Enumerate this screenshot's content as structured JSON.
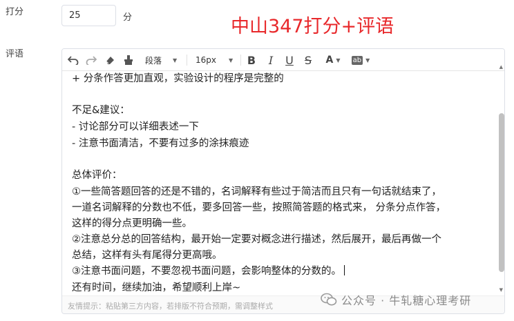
{
  "form": {
    "score_label": "打分",
    "score_value": "25",
    "score_unit": "分",
    "comment_label": "评语"
  },
  "overlay_title": "中山347打分+评语",
  "toolbar": {
    "undo_icon": "undo-icon",
    "redo_icon": "redo-icon",
    "clear_format_icon": "eraser-icon",
    "format_painter_icon": "format-painter-icon",
    "paragraph_label": "段落",
    "font_size_label": "16px",
    "bold_label": "B",
    "italic_label": "I",
    "underline_label": "U",
    "strike_label": "S",
    "font_color_label": "A",
    "bg_color_label": "ab"
  },
  "content_lines": [
    "+ 分条作答更加直观，实验设计的程序是完整的",
    "",
    "不足&建议：",
    "- 讨论部分可以详细表述一下",
    "- 注意书面清洁，不要有过多的涂抹痕迹",
    "",
    "总体评价：",
    "①一些简答题回答的还是不错的，名词解释有些过于简洁而且只有一句话就结束了，",
    "一道名词解释的分数也不低，要多回答一些，按照简答题的格式来， 分条分点作答，",
    "这样的得分点更明确一些。",
    "②注意总分总的回答结构，最开始一定要对概念进行描述，然后展开，最后再做一个",
    "总结，这样有头有尾得分更高哦。",
    "③注意书面问题，不要忽视书面问题，会影响整体的分数的。",
    "还有时间，继续加油，希望顺利上岸~"
  ],
  "footer_hint": "友情提示：粘贴第三方内容，若排版不符合预期，需调整样式",
  "watermark": {
    "text": "公众号 · 牛轧糖心理考研",
    "icon": "wechat-icon"
  },
  "colors": {
    "overlay_title": "#e8282b",
    "border": "#dcdfe6",
    "scrollbar_thumb": "#c1c1c1"
  }
}
